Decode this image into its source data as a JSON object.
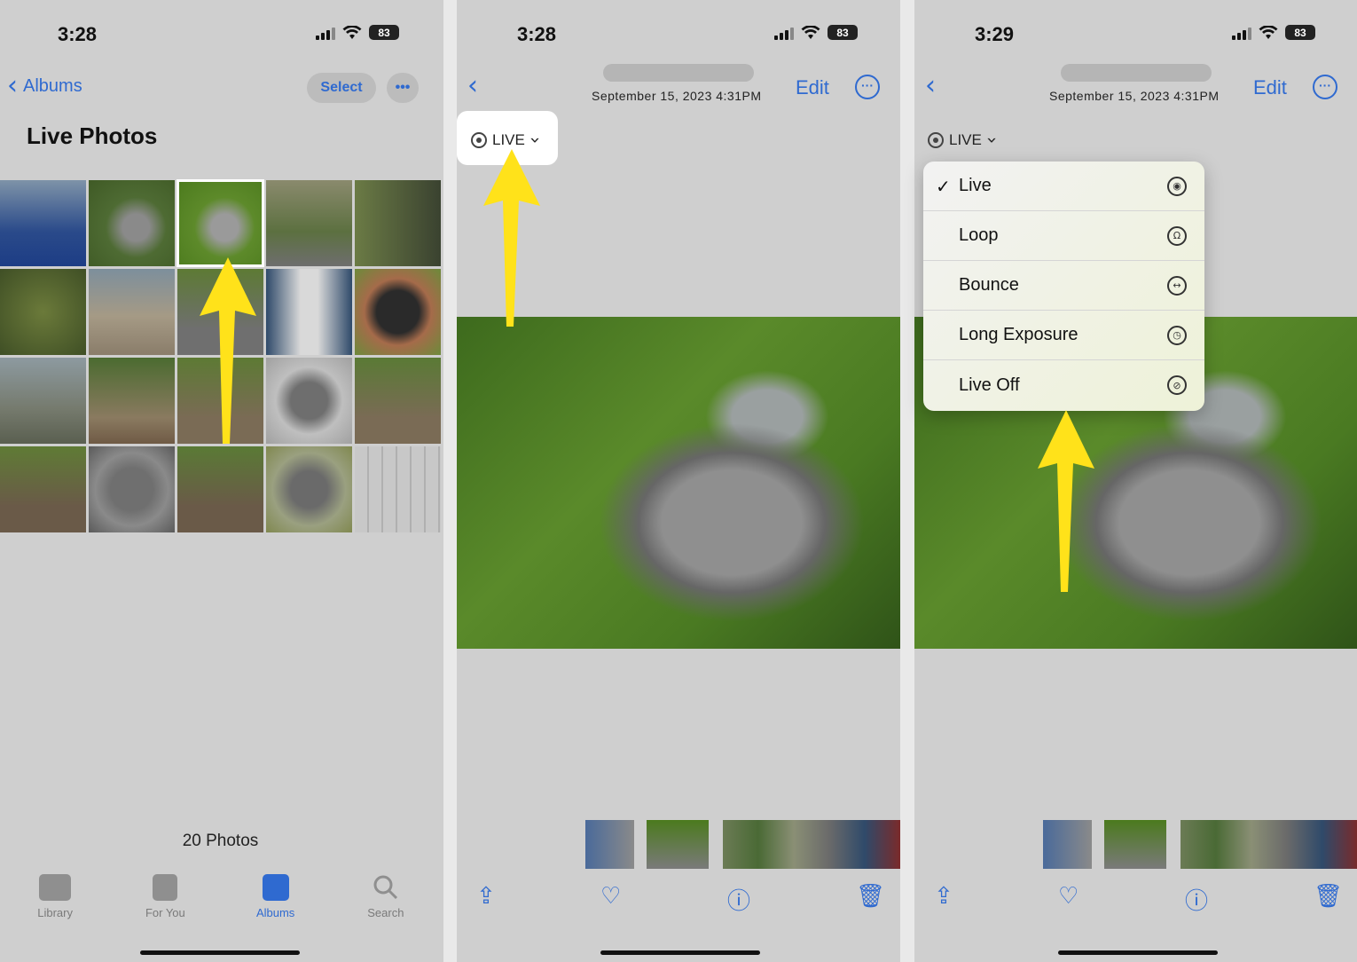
{
  "screens": [
    {
      "status": {
        "time": "3:28",
        "battery": "83"
      },
      "nav": {
        "back_label": "Albums",
        "select_label": "Select",
        "more_label": "•••"
      },
      "title": "Live Photos",
      "photo_count": "20 Photos",
      "tabs": [
        {
          "label": "Library",
          "icon": "photo-library-icon",
          "active": false
        },
        {
          "label": "For You",
          "icon": "for-you-icon",
          "active": false
        },
        {
          "label": "Albums",
          "icon": "albums-icon",
          "active": true
        },
        {
          "label": "Search",
          "icon": "search-icon",
          "active": false
        }
      ],
      "grid_thumbnails": [
        "blue-landscape",
        "cat-looking-up",
        "cat-on-grass-selected",
        "cat-on-grass",
        "cat-by-dark-wall",
        "tree-bush",
        "beach-sand",
        "cat-sitting-path",
        "qr-code-phone",
        "smartwatch-hand",
        "cat-on-path",
        "bird-on-railing",
        "bird-on-railing-2",
        "cat-back-view",
        "bird-on-railing-3",
        "birds-on-table",
        "cat-sleeping",
        "birds-on-table-2",
        "cat-sitting",
        "keyboard"
      ]
    },
    {
      "status": {
        "time": "3:28",
        "battery": "83"
      },
      "date": "September 15, 2023  4:31PM",
      "edit_label": "Edit",
      "live_label": "LIVE"
    },
    {
      "status": {
        "time": "3:29",
        "battery": "83"
      },
      "date": "September 15, 2023  4:31PM",
      "edit_label": "Edit",
      "live_label": "LIVE",
      "menu": [
        {
          "label": "Live",
          "checked": true,
          "icon": "live-icon"
        },
        {
          "label": "Loop",
          "checked": false,
          "icon": "loop-icon"
        },
        {
          "label": "Bounce",
          "checked": false,
          "icon": "bounce-icon"
        },
        {
          "label": "Long Exposure",
          "checked": false,
          "icon": "long-exposure-icon"
        },
        {
          "label": "Live Off",
          "checked": false,
          "icon": "live-off-icon"
        }
      ]
    }
  ],
  "colors": {
    "accent": "#2f6ad0",
    "arrow": "#ffe21a",
    "background_dim": "#cfcfcf"
  }
}
